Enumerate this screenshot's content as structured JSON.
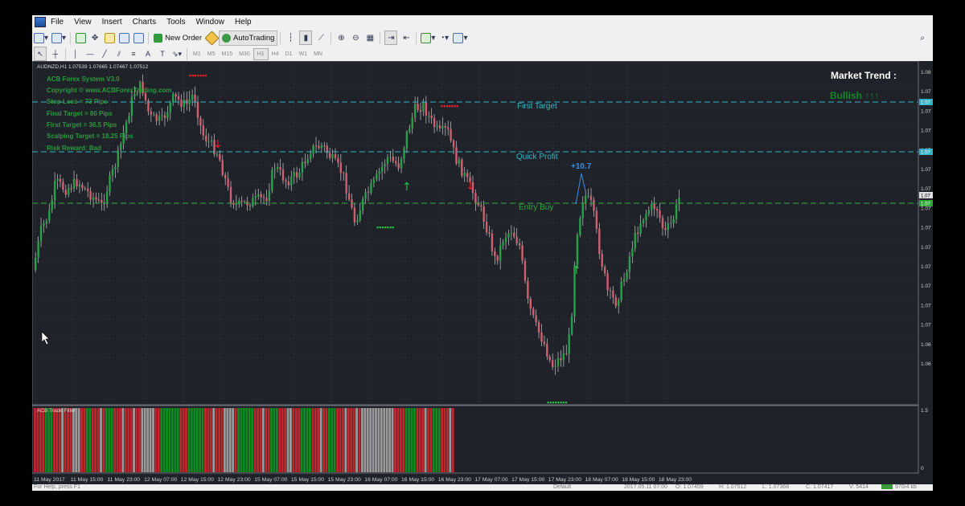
{
  "menu": {
    "items": [
      "File",
      "View",
      "Insert",
      "Charts",
      "Tools",
      "Window",
      "Help"
    ]
  },
  "toolbar": {
    "new_order": "New Order",
    "auto_trading": "AutoTrading"
  },
  "timeframes": [
    "M1",
    "M5",
    "M15",
    "M30",
    "H1",
    "H4",
    "D1",
    "W1",
    "MN"
  ],
  "timeframe_selected": "H1",
  "chart": {
    "header": "AUDNZD,H1  1.07539 1.07665 1.07467 1.07512",
    "indicator_lines": [
      "ACB Forex System V3.0",
      "Copyright © www.ACBForexTrading.com",
      "Stop Loss = 73 Pips",
      "Final Target = 80 Pips",
      "First Target = 36.5 Pips",
      "Scalping Target = 18.25 Pips",
      "Risk Reward: Bad"
    ],
    "market_trend_label": "Market Trend :",
    "market_trend_value": "Bullish ↑↑↑",
    "levels": {
      "first_target": "First Target",
      "quick_profit": "Quick Profit",
      "entry_buy": "Entry Buy"
    },
    "profit_label": "+10.7",
    "price_labels": [
      "1.08",
      "1.07",
      "1.07",
      "1.07",
      "1.07",
      "1.07",
      "1.07",
      "1.07",
      "1.07",
      "1.07",
      "1.07",
      "1.07",
      "1.07",
      "1.07",
      "1.06",
      "1.06"
    ],
    "level_tags": [
      "1.07",
      "1.07",
      "1.07",
      "1.07"
    ],
    "subwindow_title": "ACB Trade Filter",
    "subwindow_scale": [
      "1.5",
      "0"
    ],
    "time_labels": [
      "11 May 2017",
      "11 May 15:00",
      "11 May 23:00",
      "12 May 07:00",
      "12 May 15:00",
      "12 May 23:00",
      "15 May 07:00",
      "15 May 15:00",
      "15 May 23:00",
      "16 May 07:00",
      "16 May 15:00",
      "16 May 23:00",
      "17 May 07:00",
      "17 May 15:00",
      "17 May 23:00",
      "18 May 07:00",
      "18 May 15:00",
      "18 May 23:00"
    ]
  },
  "status": {
    "left": "For Help, press F1",
    "profile": "Default",
    "datetime": "2017.05.11 07:00",
    "o": "O: 1.07459",
    "h": "H: 1.07512",
    "l": "L: 1.07368",
    "c": "C: 1.07417",
    "v": "V: 5414",
    "kb": "970/4 kb"
  },
  "colors": {
    "chart_bg": "#202229",
    "grid": "#3a3d47",
    "bull": "#27a04a",
    "bear": "#d06070",
    "level_line": "#2fb6c6",
    "entry_line": "#2fa83a",
    "filter_red": "#c0272d",
    "filter_green": "#0d8c1f",
    "filter_gray": "#9a9a9a",
    "sell_dots": "#e8202a",
    "buy_dots": "#22c040"
  }
}
